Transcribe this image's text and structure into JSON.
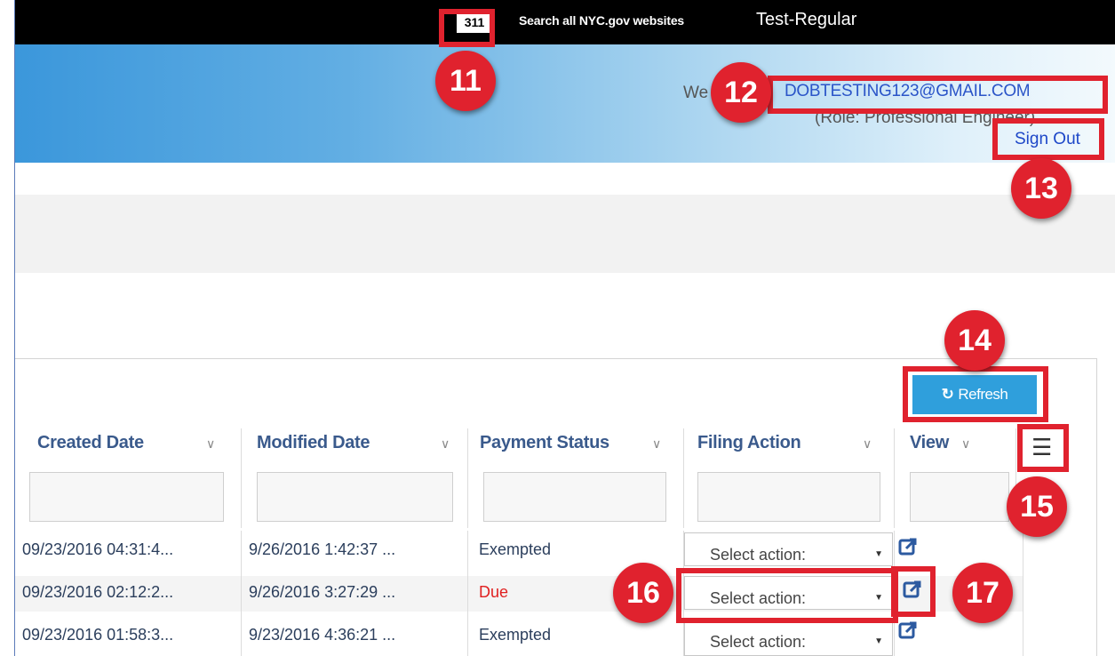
{
  "topbar": {
    "nyc311": "311",
    "search_link": "Search all NYC.gov websites",
    "environment": "Test-Regular"
  },
  "header": {
    "welcome": "We",
    "email": "DOBTESTING123@GMAIL.COM",
    "role": "(Role: Professional Engineer)",
    "sign_out": "Sign Out"
  },
  "toolbar": {
    "refresh_label": "Refresh",
    "refresh_icon": "refresh-icon"
  },
  "grid": {
    "columns": [
      {
        "label": "Created Date"
      },
      {
        "label": "Modified Date"
      },
      {
        "label": "Payment Status"
      },
      {
        "label": "Filing Action"
      },
      {
        "label": "View"
      }
    ],
    "rows": [
      {
        "created": "09/23/2016 04:31:4...",
        "modified": "9/26/2016 1:42:37 ...",
        "payment": "Exempted",
        "action": "Select action:"
      },
      {
        "created": "09/23/2016 02:12:2...",
        "modified": "9/26/2016 3:27:29 ...",
        "payment": "Due",
        "action": "Select action:"
      },
      {
        "created": "09/23/2016 01:58:3...",
        "modified": "9/23/2016 4:36:21 ...",
        "payment": "Exempted",
        "action": "Select action:"
      }
    ]
  },
  "callouts": [
    "11",
    "12",
    "13",
    "14",
    "15",
    "16",
    "17"
  ],
  "colors": {
    "callout": "#e0222e",
    "header_start": "#3b97db",
    "refresh_button": "#2f9fdc",
    "due_status": "#e02020"
  }
}
